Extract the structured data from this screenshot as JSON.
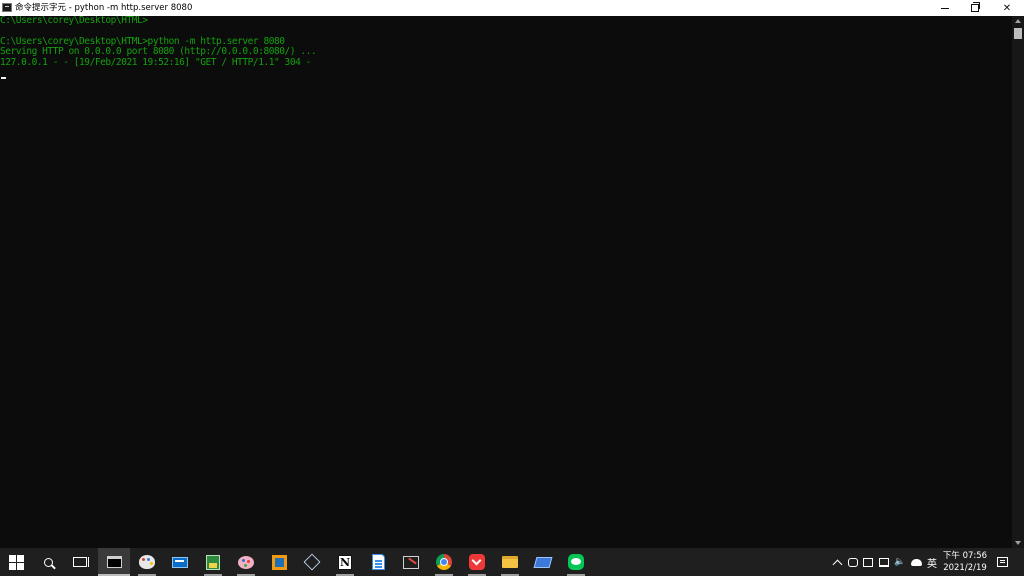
{
  "window": {
    "title": "命令提示字元 - python  -m http.server 8080",
    "icon": "cmd-icon"
  },
  "console": {
    "text_color": "#13a10e",
    "background": "#0c0c0c",
    "lines": [
      "C:\\Users\\corey\\Desktop\\HTML>",
      "",
      "C:\\Users\\corey\\Desktop\\HTML>python -m http.server 8080",
      "Serving HTTP on 0.0.0.0 port 8080 (http://0.0.0.0:8080/) ...",
      "127.0.0.1 - - [19/Feb/2021 19:52:16] \"GET / HTTP/1.1\" 304 -"
    ]
  },
  "taskbar": {
    "apps": [
      "windows-start-icon",
      "search-icon",
      "task-view-icon",
      "command-prompt-icon",
      "paint-icon",
      "mail-icon",
      "green-document-icon",
      "palette-icon",
      "orange-square-app-icon",
      "cube-app-icon",
      "notion-icon",
      "document-icon",
      "snipping-tool-icon",
      "chrome-icon",
      "vivaldi-icon",
      "file-explorer-icon",
      "remote-desktop-icon",
      "line-icon"
    ],
    "notion_letter": "N",
    "language_indicator": "英",
    "clock": {
      "time": "下午 07:56",
      "date": "2021/2/19"
    }
  }
}
